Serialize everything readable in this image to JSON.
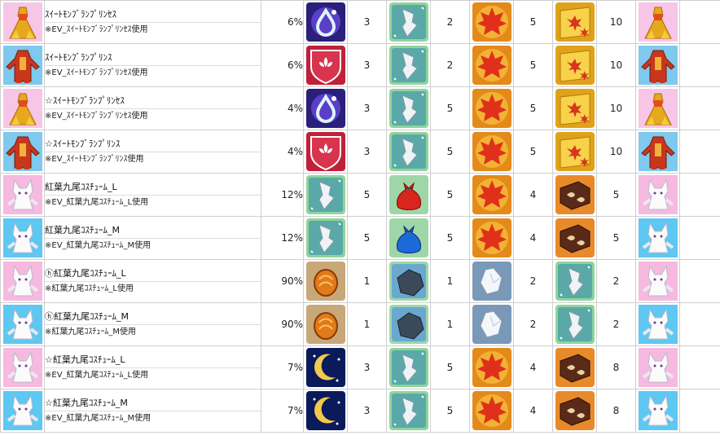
{
  "rows": [
    {
      "name": "ｽｲｰﾄﾓﾝﾌﾞﾗﾝﾌﾟﾘﾝｾｽ",
      "note": "※EV_ｽｲｰﾄﾓﾝﾌﾞﾗﾝﾌﾟﾘﾝｾｽ使用",
      "costume_icon": "princess-dress-icon",
      "rate": "6%",
      "materials": [
        {
          "icon": "purple-droplet-icon",
          "qty": "3"
        },
        {
          "icon": "silver-ore-icon",
          "qty": "2"
        },
        {
          "icon": "maple-leaf-shield-icon",
          "qty": "5"
        },
        {
          "icon": "maple-fan-icon",
          "qty": "10"
        }
      ],
      "result_icon": "princess-dress-icon"
    },
    {
      "name": "ｽｲｰﾄﾓﾝﾌﾞﾗﾝﾌﾟﾘﾝｽ",
      "note": "※EV_ｽｲｰﾄﾓﾝﾌﾞﾗﾝﾌﾟﾘﾝｾｽ使用",
      "costume_icon": "prince-outfit-icon",
      "rate": "6%",
      "materials": [
        {
          "icon": "fleur-de-lis-emblem-icon",
          "qty": "3"
        },
        {
          "icon": "silver-ore-icon",
          "qty": "2"
        },
        {
          "icon": "maple-leaf-shield-icon",
          "qty": "5"
        },
        {
          "icon": "maple-fan-icon",
          "qty": "10"
        }
      ],
      "result_icon": "prince-outfit-icon"
    },
    {
      "name": "☆ｽｲｰﾄﾓﾝﾌﾞﾗﾝﾌﾟﾘﾝｾｽ",
      "note": "※EV_ｽｲｰﾄﾓﾝﾌﾞﾗﾝﾌﾟﾘﾝｾｽ使用",
      "costume_icon": "princess-dress-icon",
      "rate": "4%",
      "materials": [
        {
          "icon": "purple-droplet-icon",
          "qty": "3"
        },
        {
          "icon": "silver-ore-icon",
          "qty": "5"
        },
        {
          "icon": "maple-leaf-shield-icon",
          "qty": "5"
        },
        {
          "icon": "maple-fan-icon",
          "qty": "10"
        }
      ],
      "result_icon": "princess-dress-icon"
    },
    {
      "name": "☆ｽｲｰﾄﾓﾝﾌﾞﾗﾝﾌﾟﾘﾝｽ",
      "note": "※EV_ｽｲｰﾄﾓﾝﾌﾞﾗﾝﾌﾟﾘﾝｽ使用",
      "costume_icon": "prince-outfit-icon",
      "rate": "4%",
      "materials": [
        {
          "icon": "fleur-de-lis-emblem-icon",
          "qty": "3"
        },
        {
          "icon": "silver-ore-icon",
          "qty": "5"
        },
        {
          "icon": "maple-leaf-shield-icon",
          "qty": "5"
        },
        {
          "icon": "maple-fan-icon",
          "qty": "10"
        }
      ],
      "result_icon": "prince-outfit-icon"
    },
    {
      "name": "紅葉九尾ｺｽﾁｭｰﾑ_L",
      "note": "※EV_紅葉九尾ｺｽﾁｭｰﾑ_L使用",
      "costume_icon": "white-fox-pink-icon",
      "rate": "12%",
      "materials": [
        {
          "icon": "silver-ore-icon",
          "qty": "5"
        },
        {
          "icon": "red-pouch-icon",
          "qty": "5"
        },
        {
          "icon": "maple-leaf-shield-icon",
          "qty": "4"
        },
        {
          "icon": "chocolate-box-icon",
          "qty": "5"
        }
      ],
      "result_icon": "white-fox-pink-icon"
    },
    {
      "name": "紅葉九尾ｺｽﾁｭｰﾑ_M",
      "note": "※EV_紅葉九尾ｺｽﾁｭｰﾑ_M使用",
      "costume_icon": "white-fox-blue-icon",
      "rate": "12%",
      "materials": [
        {
          "icon": "silver-ore-icon",
          "qty": "5"
        },
        {
          "icon": "blue-pouch-icon",
          "qty": "5"
        },
        {
          "icon": "maple-leaf-shield-icon",
          "qty": "4"
        },
        {
          "icon": "chocolate-box-icon",
          "qty": "5"
        }
      ],
      "result_icon": "white-fox-blue-icon"
    },
    {
      "name": "ⓗ紅葉九尾ｺｽﾁｭｰﾑ_L",
      "note": "※紅葉九尾ｺｽﾁｭｰﾑ_L使用",
      "costume_icon": "white-fox-pink-icon",
      "rate": "90%",
      "materials": [
        {
          "icon": "amber-gem-icon",
          "qty": "1"
        },
        {
          "icon": "dark-stone-icon",
          "qty": "1"
        },
        {
          "icon": "crystal-shard-icon",
          "qty": "2"
        },
        {
          "icon": "silver-ore-icon",
          "qty": "2"
        }
      ],
      "result_icon": "white-fox-pink-icon"
    },
    {
      "name": "ⓗ紅葉九尾ｺｽﾁｭｰﾑ_M",
      "note": "※紅葉九尾ｺｽﾁｭｰﾑ_M使用",
      "costume_icon": "white-fox-blue-icon",
      "rate": "90%",
      "materials": [
        {
          "icon": "amber-gem-icon",
          "qty": "1"
        },
        {
          "icon": "dark-stone-icon",
          "qty": "1"
        },
        {
          "icon": "crystal-shard-icon",
          "qty": "2"
        },
        {
          "icon": "silver-ore-icon",
          "qty": "2"
        }
      ],
      "result_icon": "white-fox-blue-icon"
    },
    {
      "name": "☆紅葉九尾ｺｽﾁｭｰﾑ_L",
      "note": "※EV_紅葉九尾ｺｽﾁｭｰﾑ_L使用",
      "costume_icon": "white-fox-pink-icon",
      "rate": "7%",
      "materials": [
        {
          "icon": "crescent-moon-icon",
          "qty": "3"
        },
        {
          "icon": "silver-ore-icon",
          "qty": "5"
        },
        {
          "icon": "maple-leaf-shield-icon",
          "qty": "4"
        },
        {
          "icon": "chocolate-box-icon",
          "qty": "8"
        }
      ],
      "result_icon": "white-fox-pink-icon"
    },
    {
      "name": "☆紅葉九尾ｺｽﾁｭｰﾑ_M",
      "note": "※EV_紅葉九尾ｺｽﾁｭｰﾑ_M使用",
      "costume_icon": "white-fox-blue-icon",
      "rate": "7%",
      "materials": [
        {
          "icon": "crescent-moon-icon",
          "qty": "3"
        },
        {
          "icon": "silver-ore-icon",
          "qty": "5"
        },
        {
          "icon": "maple-leaf-shield-icon",
          "qty": "4"
        },
        {
          "icon": "chocolate-box-icon",
          "qty": "8"
        }
      ],
      "result_icon": "white-fox-blue-icon"
    }
  ]
}
